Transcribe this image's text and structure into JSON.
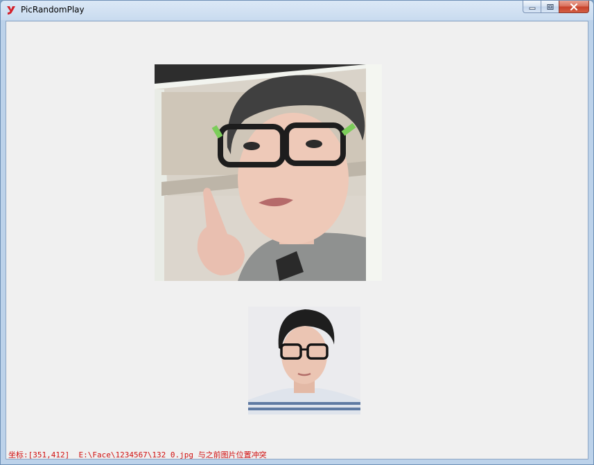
{
  "window": {
    "title": "PicRandomPlay",
    "app_icon": "y-logo-icon",
    "accent_color": "#d4202a"
  },
  "caption_buttons": {
    "minimize": "minimize-icon",
    "maximize": "maximize-icon",
    "close": "close-icon"
  },
  "photos": [
    {
      "name": "photo-main",
      "subject": "face-photo-glasses-pointing"
    },
    {
      "name": "photo-small",
      "subject": "face-photo-glasses-portrait"
    }
  ],
  "status": {
    "text": "坐标:[351,412]  E:\\Face\\1234567\\132_0.jpg 与之前图片位置冲突",
    "color": "#d01010"
  }
}
